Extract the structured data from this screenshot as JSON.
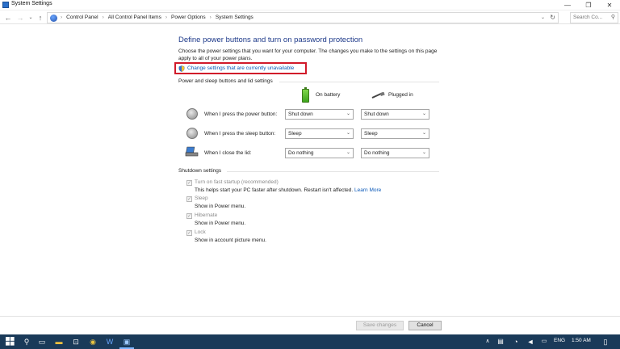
{
  "window": {
    "title": "System Settings",
    "controls": {
      "minimize": "—",
      "maximize": "❐",
      "close": "✕"
    }
  },
  "address_bar": {
    "breadcrumbs": [
      "Control Panel",
      "All Control Panel Items",
      "Power Options",
      "System Settings"
    ],
    "search_placeholder": "Search Co..."
  },
  "page": {
    "heading": "Define power buttons and turn on password protection",
    "description": "Choose the power settings that you want for your computer. The changes you make to the settings on this page apply to all of your power plans.",
    "change_settings_link": "Change settings that are currently unavailable",
    "highlight_color": "#d11a2a"
  },
  "power_section": {
    "title": "Power and sleep buttons and lid settings",
    "columns": {
      "battery": "On battery",
      "plugged": "Plugged in"
    },
    "rows": [
      {
        "label": "When I press the power button:",
        "battery": "Shut down",
        "plugged": "Shut down",
        "icon": "power-button-icon"
      },
      {
        "label": "When I press the sleep button:",
        "battery": "Sleep",
        "plugged": "Sleep",
        "icon": "sleep-button-icon"
      },
      {
        "label": "When I close the lid:",
        "battery": "Do nothing",
        "plugged": "Do nothing",
        "icon": "laptop-lid-icon"
      }
    ]
  },
  "shutdown_section": {
    "title": "Shutdown settings",
    "items": [
      {
        "label": "Turn on fast startup (recommended)",
        "sub": "This helps start your PC faster after shutdown. Restart isn't affected.",
        "link": "Learn More",
        "checked": true
      },
      {
        "label": "Sleep",
        "sub": "Show in Power menu.",
        "checked": true
      },
      {
        "label": "Hibernate",
        "sub": "Show in Power menu.",
        "checked": true
      },
      {
        "label": "Lock",
        "sub": "Show in account picture menu.",
        "checked": true
      }
    ]
  },
  "buttons": {
    "save": "Save changes",
    "cancel": "Cancel"
  },
  "taskbar": {
    "language": "ENG",
    "time": "1:50 AM",
    "background": "#1a3a59"
  }
}
